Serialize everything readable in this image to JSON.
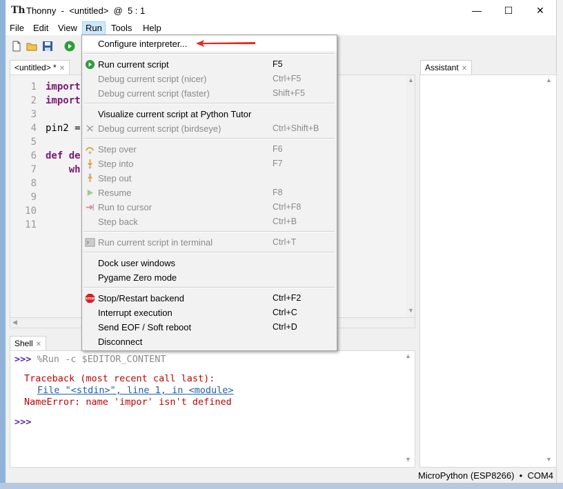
{
  "window": {
    "app_name": "Thonny",
    "title_sep": "-",
    "file": "<untitled>",
    "position": "@  5 : 1",
    "minimize": "—",
    "maximize": "☐",
    "close": "✕"
  },
  "menubar": [
    "File",
    "Edit",
    "View",
    "Run",
    "Tools",
    "Help"
  ],
  "editor": {
    "tab_label": "<untitled> *",
    "line_numbers": [
      "1",
      "2",
      "3",
      "4",
      "5",
      "6",
      "7",
      "8",
      "9",
      "10",
      "11"
    ],
    "code": {
      "l1": "import",
      "l2": "import",
      "l4": "pin2 =",
      "l6_kw": "def",
      "l6_rest": " de",
      "l7": "    wh"
    }
  },
  "assistant": {
    "tab_label": "Assistant"
  },
  "shell": {
    "tab_label": "Shell",
    "prompt": ">>>",
    "command": " %Run -c $EDITOR_CONTENT",
    "traceback": "Traceback (most recent call last):",
    "file_line": "File \"<stdin>\", line 1, in <module>",
    "error": "NameError: name 'impor' isn't defined",
    "prompt2": ">>>"
  },
  "status": {
    "interpreter": "MicroPython (ESP8266)  •  COM4"
  },
  "run_menu": {
    "configure": "Configure interpreter...",
    "items_a": [
      {
        "label": "Run current script",
        "shortcut": "F5",
        "enabled": true,
        "icon": "run-icon"
      },
      {
        "label": "Debug current script (nicer)",
        "shortcut": "Ctrl+F5",
        "enabled": false
      },
      {
        "label": "Debug current script (faster)",
        "shortcut": "Shift+F5",
        "enabled": false
      }
    ],
    "items_b": [
      {
        "label": "Visualize current script at Python Tutor",
        "shortcut": "",
        "enabled": true
      },
      {
        "label": "Debug current script (birdseye)",
        "shortcut": "Ctrl+Shift+B",
        "enabled": false,
        "icon": "birdseye-icon"
      }
    ],
    "items_c": [
      {
        "label": "Step over",
        "shortcut": "F6",
        "enabled": false,
        "icon": "step-over-icon"
      },
      {
        "label": "Step into",
        "shortcut": "F7",
        "enabled": false,
        "icon": "step-into-icon"
      },
      {
        "label": "Step out",
        "shortcut": "",
        "enabled": false,
        "icon": "step-out-icon"
      },
      {
        "label": "Resume",
        "shortcut": "F8",
        "enabled": false,
        "icon": "resume-icon"
      },
      {
        "label": "Run to cursor",
        "shortcut": "Ctrl+F8",
        "enabled": false,
        "icon": "run-to-cursor-icon"
      },
      {
        "label": "Step back",
        "shortcut": "Ctrl+B",
        "enabled": false
      }
    ],
    "items_d": [
      {
        "label": "Run current script in terminal",
        "shortcut": "Ctrl+T",
        "enabled": false,
        "icon": "terminal-icon"
      }
    ],
    "items_e": [
      {
        "label": "Dock user windows",
        "shortcut": "",
        "enabled": true
      },
      {
        "label": "Pygame Zero mode",
        "shortcut": "",
        "enabled": true
      }
    ],
    "items_f": [
      {
        "label": "Stop/Restart backend",
        "shortcut": "Ctrl+F2",
        "enabled": true,
        "icon": "stop-icon"
      },
      {
        "label": "Interrupt execution",
        "shortcut": "Ctrl+C",
        "enabled": true
      },
      {
        "label": "Send EOF / Soft reboot",
        "shortcut": "Ctrl+D",
        "enabled": true
      },
      {
        "label": "Disconnect",
        "shortcut": "",
        "enabled": true
      }
    ]
  },
  "colors": {
    "keyword": "#7a1772",
    "error": "#c00000",
    "prompt": "#5a2aa6",
    "menu_highlight": "#cce8ff",
    "annotation_arrow": "#e8281e"
  }
}
